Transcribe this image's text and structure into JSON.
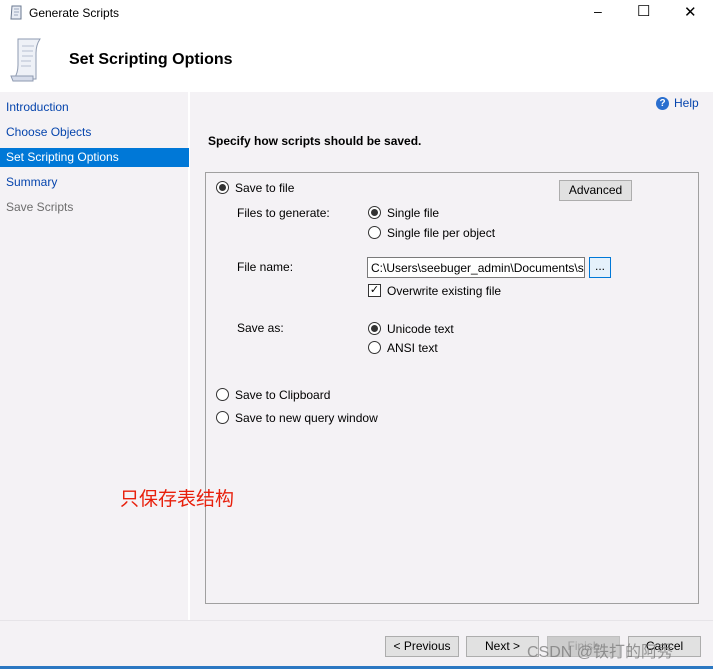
{
  "window": {
    "title": "Generate Scripts",
    "minimize": "–",
    "maximize": "☐",
    "close": "✕"
  },
  "header": {
    "title": "Set Scripting Options"
  },
  "sidebar": {
    "items": [
      {
        "label": "Introduction",
        "state": "link"
      },
      {
        "label": "Choose Objects",
        "state": "link"
      },
      {
        "label": "Set Scripting Options",
        "state": "active"
      },
      {
        "label": "Summary",
        "state": "link"
      },
      {
        "label": "Save Scripts",
        "state": "disabled"
      }
    ]
  },
  "main": {
    "help": "Help",
    "instruction": "Specify how scripts should be saved.",
    "save_to_file": "Save to file",
    "advanced": "Advanced",
    "files_to_generate_label": "Files to generate:",
    "single_file": "Single file",
    "single_file_per_object": "Single file per object",
    "file_name_label": "File name:",
    "file_name_value": "C:\\Users\\seebuger_admin\\Documents\\script.sql",
    "browse": "...",
    "overwrite": "Overwrite existing file",
    "overwrite_checked": true,
    "save_as_label": "Save as:",
    "unicode_text": "Unicode text",
    "ansi_text": "ANSI text",
    "save_to_clipboard": "Save to Clipboard",
    "save_to_query_window": "Save to new query window",
    "annotation": "只保存表结构"
  },
  "footer": {
    "previous": "< Previous",
    "next": "Next >",
    "finish": "Finish",
    "cancel": "Cancel",
    "watermark": "CSDN @铁打的阿秀"
  },
  "colors": {
    "accent": "#0078d7",
    "annotation": "#e8200c",
    "link": "#0645ad"
  }
}
